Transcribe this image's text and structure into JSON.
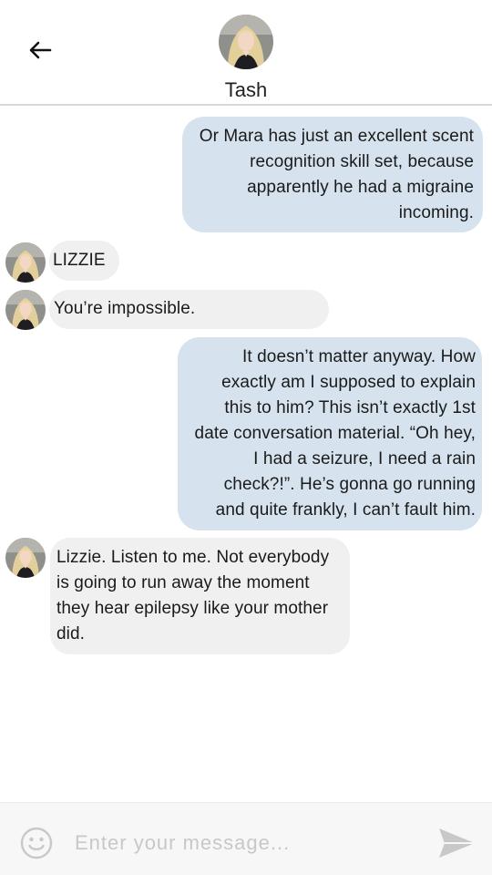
{
  "header": {
    "contact_name": "Tash"
  },
  "messages": [
    {
      "direction": "out",
      "text": "Or Mara has just an excellent scent recognition skill set, because apparently he had a migraine incoming."
    },
    {
      "direction": "in",
      "text": "LIZZIE"
    },
    {
      "direction": "in",
      "text": "You’re impossible."
    },
    {
      "direction": "out",
      "text": "It doesn’t matter anyway. How exactly am I supposed to explain this to him? This isn’t exactly 1st date conversation material. “Oh hey, I had a seizure, I need a rain check?!”. He’s gonna go running and quite frankly, I can’t fault him."
    },
    {
      "direction": "in",
      "text": "Lizzie. Listen to me. Not everybody is going to run away the moment they hear epilepsy like your mother did."
    }
  ],
  "composer": {
    "placeholder": "Enter your message...",
    "value": ""
  },
  "icons": {
    "back": "arrow-left-icon",
    "emoji": "smiley-icon",
    "send": "send-icon"
  },
  "colors": {
    "outgoing_bubble": "#d6e3ee",
    "incoming_bubble": "#f0f0f0",
    "divider": "#d8d8d8",
    "send_icon": "#c8c8c8"
  }
}
